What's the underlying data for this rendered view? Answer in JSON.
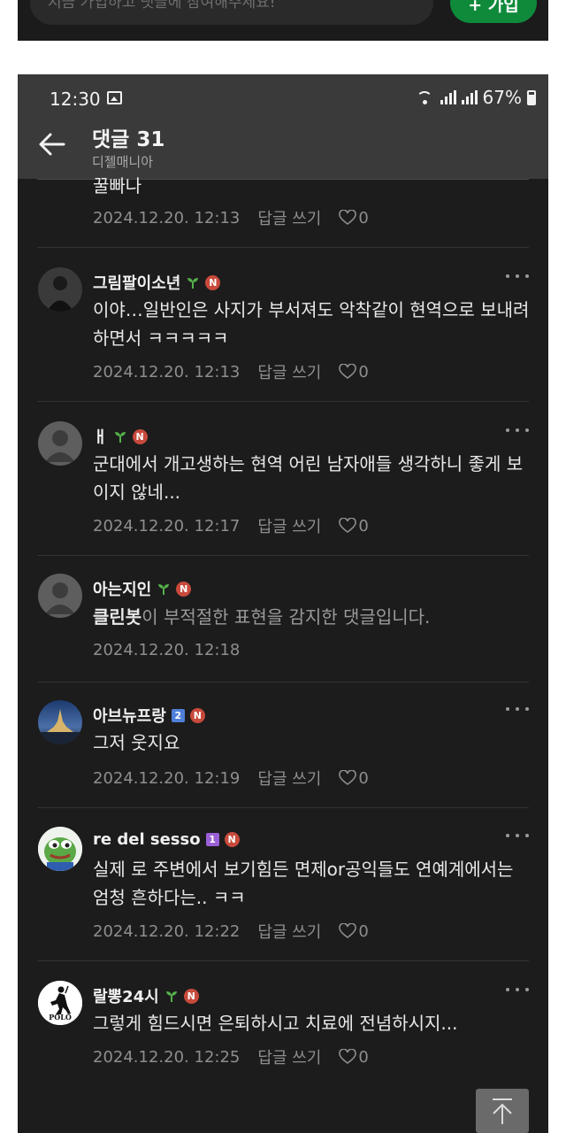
{
  "top_bar": {
    "input_placeholder": "지금 가입하고 댓글에 참여해주세요!",
    "join_button": "+ 가입"
  },
  "status_bar": {
    "time": "12:30",
    "battery": "67%"
  },
  "header": {
    "title": "댓글 31",
    "subtitle": "디젤매니아"
  },
  "cut_comment": {
    "text": "꿀빠나",
    "date": "2024.12.20. 12:13",
    "reply": "답글 쓰기",
    "likes": "0"
  },
  "comments": [
    {
      "name": "그림팔이소년",
      "text": "이야…일반인은 사지가 부서져도 악착같이 현역으로 보내려하면서 ㅋㅋㅋㅋㅋ",
      "date": "2024.12.20. 12:13",
      "reply": "답글 쓰기",
      "likes": "0",
      "badge": "N"
    },
    {
      "name": "ㅐ",
      "text": "군대에서 개고생하는 현역 어린 남자애들 생각하니 좋게 보이지 않네...",
      "date": "2024.12.20. 12:17",
      "reply": "답글 쓰기",
      "likes": "0",
      "badge": "N"
    },
    {
      "name": "아는지인",
      "cleanbot": "클린봇",
      "text": "이 부적절한 표현을 감지한 댓글입니다.",
      "date": "2024.12.20. 12:18",
      "badge": "N"
    },
    {
      "name": "아브뉴프랑",
      "level": "2",
      "text": "그저 웃지요",
      "date": "2024.12.20. 12:19",
      "reply": "답글 쓰기",
      "likes": "0",
      "badge": "N"
    },
    {
      "name": "re del sesso",
      "level": "1",
      "text": "실제 로 주변에서 보기힘든 면제or공익들도 연예계에서는 엄청 흔하다는.. ㅋㅋ",
      "date": "2024.12.20. 12:22",
      "reply": "답글 쓰기",
      "likes": "0",
      "badge": "N"
    },
    {
      "name": "랄뽕24시",
      "avatar_text": "POLO",
      "text": "그렇게 힘드시면 은퇴하시고 치료에 전념하시지...",
      "date": "2024.12.20. 12:25",
      "reply": "답글 쓰기",
      "likes": "0",
      "badge": "N"
    }
  ]
}
